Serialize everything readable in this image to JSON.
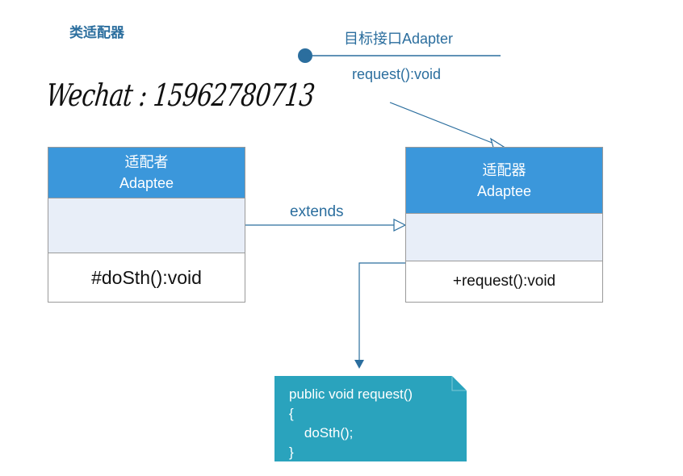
{
  "title": "类适配器",
  "watermark": "Wechat : 15962780713",
  "interface": {
    "name": "目标接口Adapter",
    "method": "request():void"
  },
  "adaptee": {
    "name_cn": "适配者",
    "name_en": "Adaptee",
    "operation": "#doSth():void"
  },
  "adapter": {
    "name_cn": "适配器",
    "name_en": "Adaptee",
    "operation": "+request():void"
  },
  "relation": {
    "extends_label": "extends"
  },
  "note": {
    "lines": [
      "public void request()",
      "{",
      "    doSth();",
      "}"
    ]
  },
  "colors": {
    "header_blue": "#3b97db",
    "attr_fill": "#e8eef8",
    "line_blue": "#2b6e9e",
    "note_teal": "#2aa3bd"
  }
}
